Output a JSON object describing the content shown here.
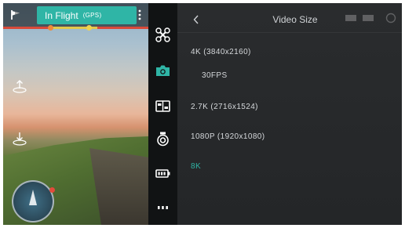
{
  "status_bar": {
    "flight_status": "In Flight",
    "gps_label": "(GPS)",
    "home_icon": "flag-icon",
    "more_icon": "vertical-dots-icon"
  },
  "left_controls": {
    "takeoff_icon": "takeoff-icon",
    "land_icon": "landing-icon",
    "radar_icon": "attitude-radar"
  },
  "toolbar": {
    "items": [
      {
        "icon": "drone-icon",
        "active": false
      },
      {
        "icon": "camera-icon",
        "active": true
      },
      {
        "icon": "image-settings-icon",
        "active": false
      },
      {
        "icon": "gimbal-icon",
        "active": false
      },
      {
        "icon": "battery-icon",
        "active": false
      },
      {
        "icon": "more-dots-icon",
        "active": false
      }
    ]
  },
  "panel": {
    "title": "Video Size",
    "back_icon": "chevron-left-icon",
    "options": [
      {
        "label": "4K (3840x2160)"
      },
      {
        "label": "30FPS"
      },
      {
        "label": "2.7K (2716x1524)"
      },
      {
        "label": "1080P (1920x1080)"
      },
      {
        "label": "8K",
        "selected": true
      }
    ]
  },
  "colors": {
    "accent": "#2fb5a6",
    "panel_bg": "#2a2c2e",
    "toolbar_bg": "#111314",
    "progress_red": "#d94a3a",
    "progress_yellow": "#e2c84a"
  }
}
